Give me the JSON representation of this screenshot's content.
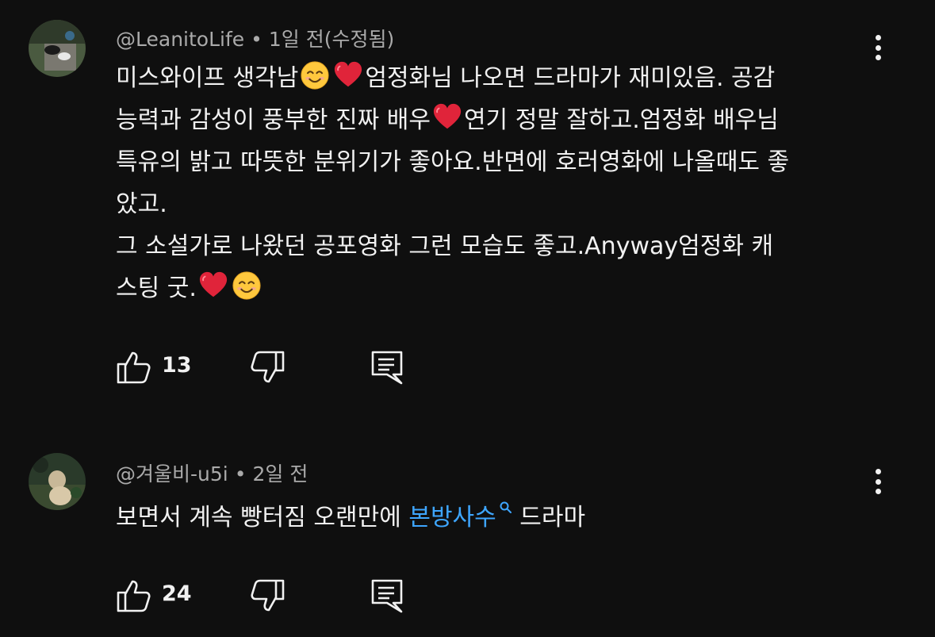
{
  "comments": [
    {
      "author": "@LeanitoLife",
      "time": "1일 전(수정됨)",
      "line1_a": "미스와이프 생각남",
      "line1_b": "엄정화님 나오면 드라마가 재미있음. 공감",
      "line2_a": "능력과 감성이 풍부한 진짜 배우",
      "line2_b": "연기 정말 잘하고.엄정화 배우님",
      "line3": "특유의 밝고 따뜻한 분위기가 좋아요.반면에 호러영화에 나올때도 좋",
      "line4": "았고.",
      "line5": "그 소설가로 나왔던 공포영화 그런 모습도 좋고.Anyway엄정화 캐",
      "line6_a": "스팅 굿.",
      "likes": "13"
    },
    {
      "author": "@겨울비-u5i",
      "time": "2일 전",
      "text_a": "보면서 계속 빵터짐  오랜만에 ",
      "link": "본방사수",
      "text_b": " 드라마",
      "likes": "24"
    }
  ],
  "icons": {
    "like": "thumbs-up-icon",
    "dislike": "thumbs-down-icon",
    "reply": "reply-icon",
    "more": "more-vertical-icon",
    "search": "search-icon",
    "smile": "smiling-face-emoji",
    "heart": "red-heart-emoji"
  },
  "colors": {
    "background": "#0f0f0f",
    "text": "#f1f1f1",
    "meta": "#aaaaaa",
    "link": "#3ea6ff",
    "heart": "#e0243a",
    "smile": "#ffc83d"
  }
}
